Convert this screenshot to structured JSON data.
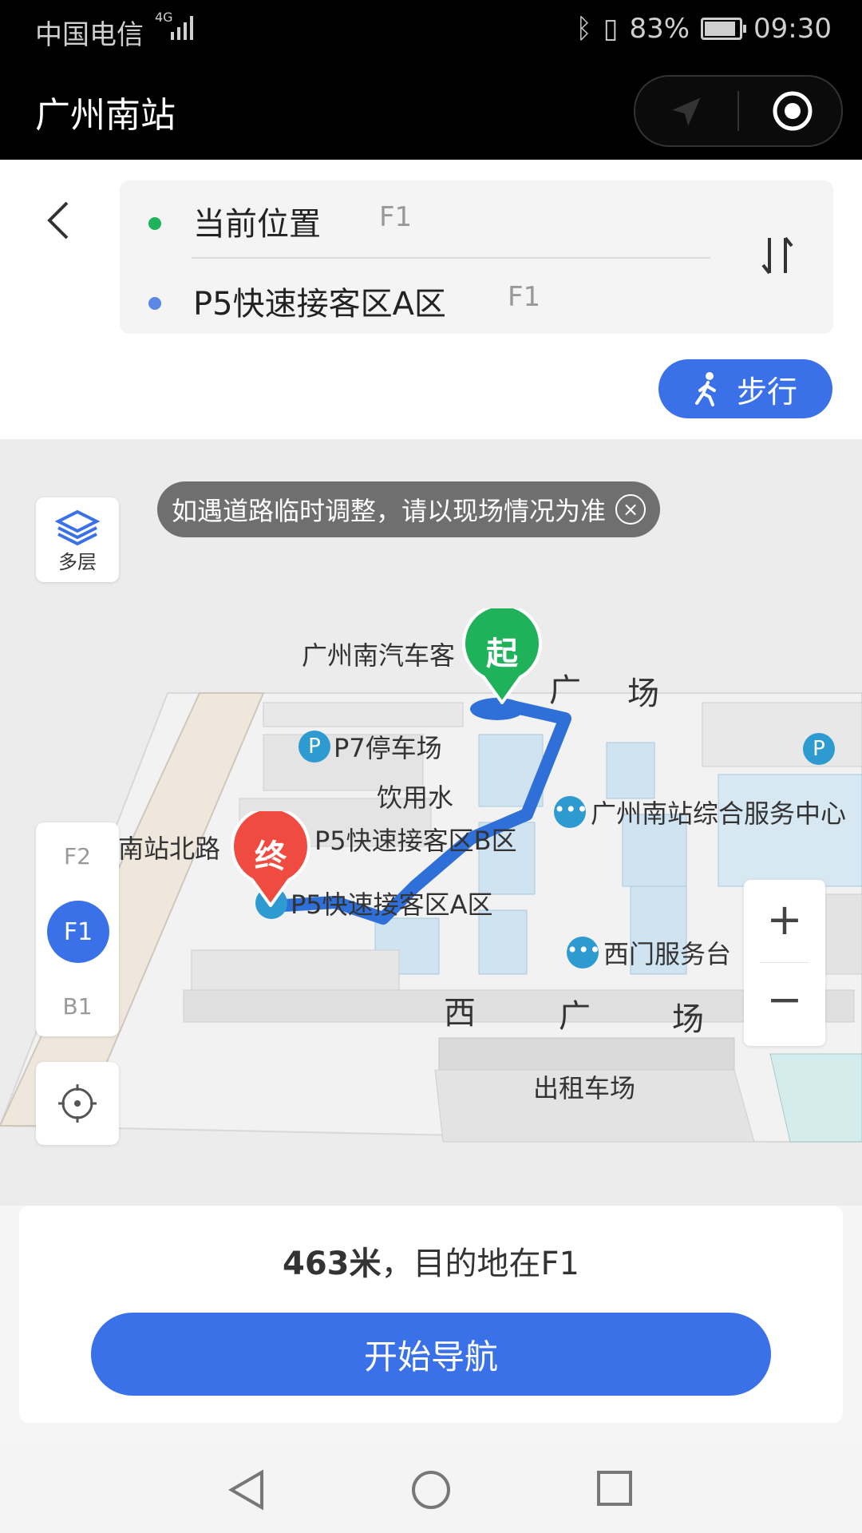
{
  "status_bar": {
    "carrier": "中国电信",
    "signal": "4G",
    "battery": "83%",
    "battery_level": 0.83,
    "time": "09:30"
  },
  "title_bar": {
    "title": "广州南站"
  },
  "route": {
    "origin": {
      "label": "当前位置",
      "floor": "F1",
      "color": "#1fb25a"
    },
    "destination": {
      "label": "P5快速接客区A区",
      "floor": "F1",
      "color": "#5b86e5"
    }
  },
  "walk_mode": {
    "label": "步行"
  },
  "map": {
    "notice": "如遇道路临时调整，请以现场情况为准",
    "layers_label": "多层",
    "floors": [
      "F2",
      "F1",
      "B1"
    ],
    "active_floor": "F1",
    "start_marker": "起",
    "end_marker": "终",
    "labels": {
      "bus_station": "广州南汽车客",
      "plaza_top_1": "广",
      "plaza_top_2": "场",
      "p7": "P7停车场",
      "water": "饮用水",
      "service_center": "广州南站综合服务中心",
      "north_road": "南站北路",
      "p5b": "P5快速接客区B区",
      "p5a": "P5快速接客区A区",
      "west_service": "西门服务台",
      "west_1": "西",
      "west_2": "广",
      "west_3": "场",
      "taxi": "出租车场",
      "parking_icon": "P"
    },
    "zoom_in": "+",
    "zoom_out": "−"
  },
  "summary": {
    "distance": "463米",
    "destination_text": "，目的地在F1"
  },
  "start_button": "开始导航",
  "accent_color": "#3b71e8"
}
